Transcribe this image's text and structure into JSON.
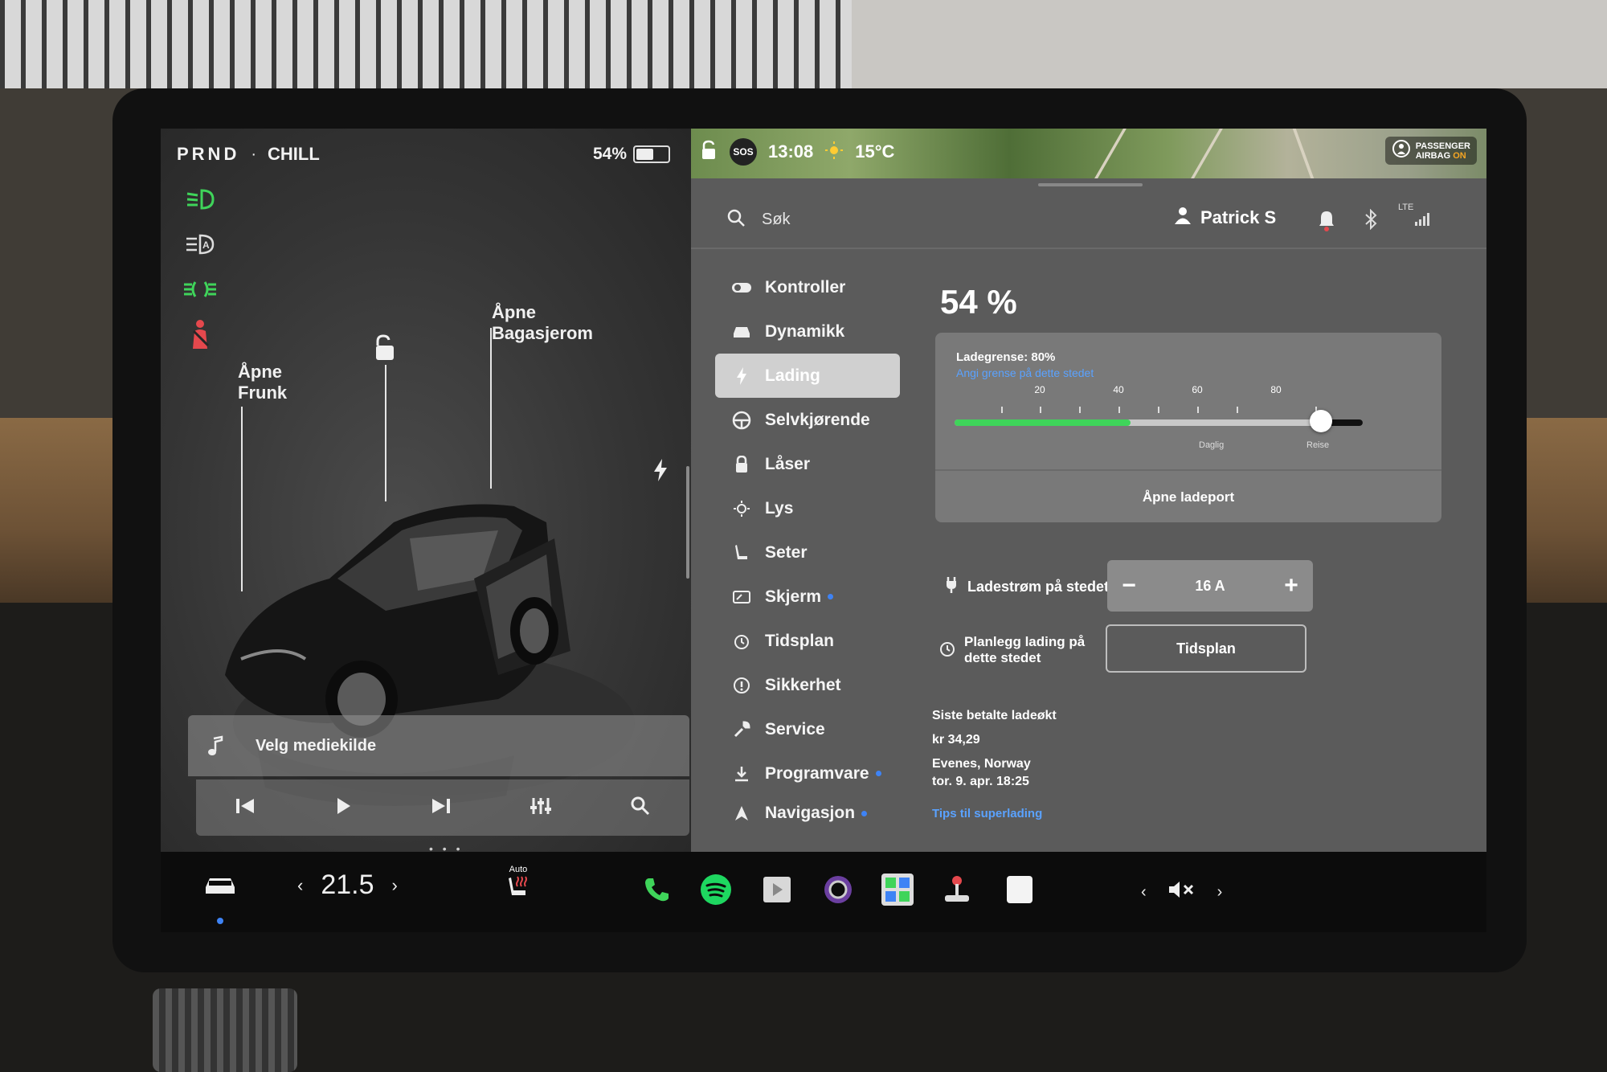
{
  "status_bar": {
    "gear": "PRND",
    "separator": "·",
    "drive_mode": "CHILL",
    "battery_percent": "54%",
    "battery_level": 0.54
  },
  "car_view": {
    "frunk_label": "Åpne\nFrunk",
    "trunk_label": "Åpne\nBagasjerom"
  },
  "media": {
    "source_label": "Velg mediekilde",
    "pager": "• • •"
  },
  "top_bar": {
    "time": "13:08",
    "temperature": "15°C",
    "sos": "SOS",
    "airbag_line1": "PASSENGER",
    "airbag_line2": "AIRBAG",
    "airbag_status": "ON",
    "lte": "LTE"
  },
  "search": {
    "placeholder": "Søk"
  },
  "profile": {
    "name": "Patrick S"
  },
  "nav": {
    "items": [
      {
        "label": "Kontroller"
      },
      {
        "label": "Dynamikk"
      },
      {
        "label": "Lading"
      },
      {
        "label": "Selvkjørende"
      },
      {
        "label": "Låser"
      },
      {
        "label": "Lys"
      },
      {
        "label": "Seter"
      },
      {
        "label": "Skjerm"
      },
      {
        "label": "Tidsplan"
      },
      {
        "label": "Sikkerhet"
      },
      {
        "label": "Service"
      },
      {
        "label": "Programvare"
      },
      {
        "label": "Navigasjon"
      }
    ]
  },
  "charging": {
    "battery": "54 %",
    "limit_title": "Ladegrense: 80%",
    "limit_link": "Angi grense på dette stedet",
    "ticks": [
      "20",
      "40",
      "60",
      "80"
    ],
    "battery_fill_fraction": 0.54,
    "limit_fraction": 0.8,
    "zone_daily": "Daglig",
    "zone_trip": "Reise",
    "open_port": "Åpne ladeport",
    "current_label": "Ladestrøm på stedet",
    "current_minus": "−",
    "current_value": "16 A",
    "current_plus": "+",
    "schedule_label": "Planlegg lading på dette stedet",
    "schedule_button": "Tidsplan",
    "last_title": "Siste betalte ladeøkt",
    "last_amount": "kr 34,29",
    "last_location": "Evenes, Norway",
    "last_date": "tor. 9. apr. 18:25",
    "sc_link": "Tips til superlading"
  },
  "dock": {
    "temp_left": "‹",
    "temp_value": "21.5",
    "temp_right": "›",
    "seat_heat_label": "Auto",
    "vol_left": "‹",
    "vol_right": "›"
  },
  "colors": {
    "accent_green": "#3fd45a",
    "link_blue": "#5aa2ff",
    "warning_red": "#e5484d"
  }
}
